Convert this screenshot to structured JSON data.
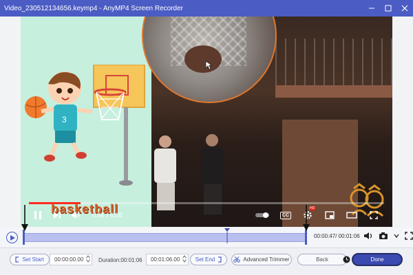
{
  "window": {
    "title": "Video_230512134656.keymp4 - AnyMP4 Screen Recorder",
    "accent": "#4b5cc4"
  },
  "player": {
    "current_time": "0:54",
    "separator": "/",
    "duration": "6:08",
    "progress_fraction": 0.146,
    "overlay_brand": "basketball",
    "controls": [
      "pause-icon",
      "next-icon",
      "volume-icon",
      "autoplay-toggle",
      "cc-icon",
      "settings-icon",
      "miniplayer-icon",
      "theater-icon",
      "fullscreen-icon"
    ],
    "cc_label": "CC",
    "hd_badge": "HD"
  },
  "timeline": {
    "time_readout": "00:00:47/ 00:01:06",
    "playhead_fraction": 0.72,
    "icons": [
      "volume-icon",
      "camera-icon",
      "chevron-down-icon",
      "expand-icon"
    ]
  },
  "trim": {
    "set_start_label": "Set Start",
    "start_value": "00:00:00.00",
    "duration_label": "Duration:00:01:06",
    "end_value": "00:01:06.00",
    "set_end_label": "Set End",
    "advanced_trimmer_label": "Advanced Trimmer",
    "back_label": "Back",
    "done_label": "Done"
  }
}
